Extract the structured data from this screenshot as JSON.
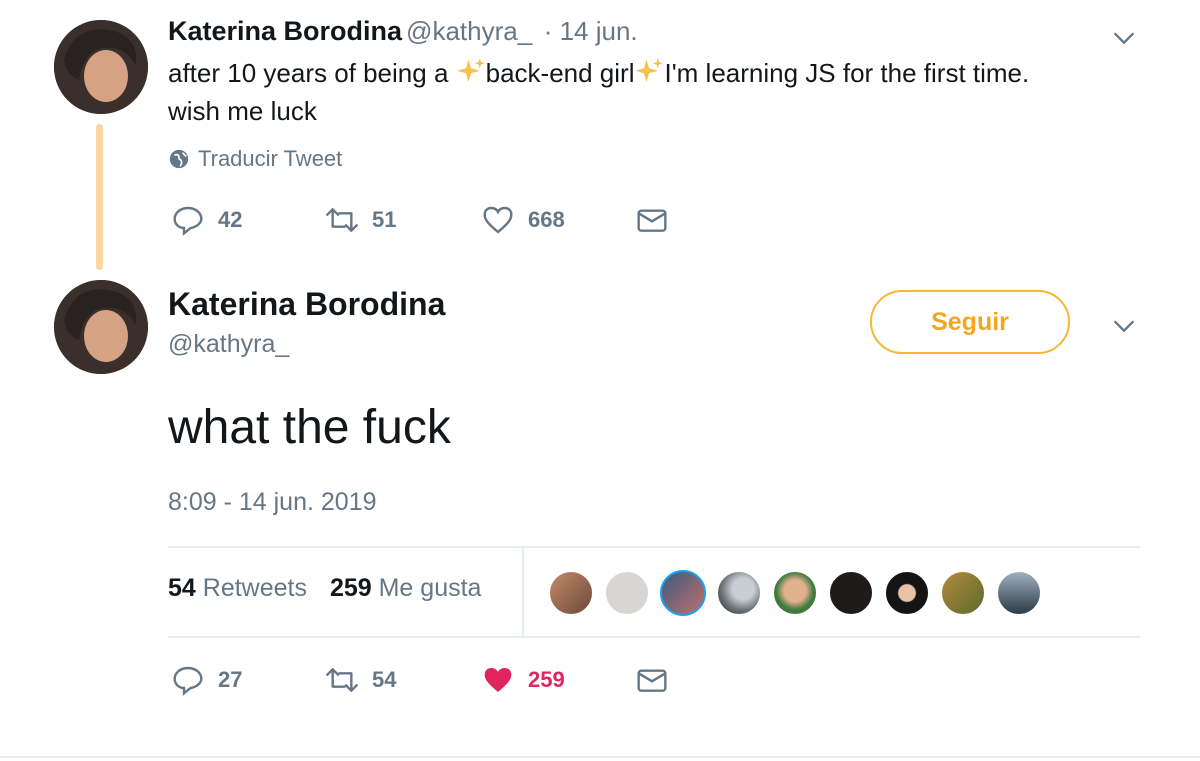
{
  "tweet1": {
    "name": "Katerina Borodina",
    "handle": "@kathyra_",
    "date": "· 14 jun.",
    "text_part1": "after 10 years of being a ",
    "text_part2": "back-end girl",
    "text_part3": "I'm learning JS for the first time.",
    "text_line2": "wish me luck",
    "translate_label": "Traducir Tweet",
    "replies": "42",
    "retweets": "51",
    "likes": "668"
  },
  "tweet2": {
    "name": "Katerina Borodina",
    "handle": "@kathyra_",
    "follow_label": "Seguir",
    "text": "what the fuck",
    "timestamp": "8:09 - 14 jun. 2019",
    "retweet_count": "54",
    "retweet_label": "Retweets",
    "like_count": "259",
    "like_label": "Me gusta",
    "replies": "27",
    "retweets": "54",
    "likes": "259"
  },
  "colors": {
    "accent": "#f4a623",
    "like": "#e0245e",
    "muted": "#657786",
    "thread": "#fad8a0"
  },
  "icons": [
    "globe-icon",
    "reply-icon",
    "retweet-icon",
    "heart-icon",
    "mail-icon",
    "chevron-down-icon",
    "sparkles-icon"
  ]
}
